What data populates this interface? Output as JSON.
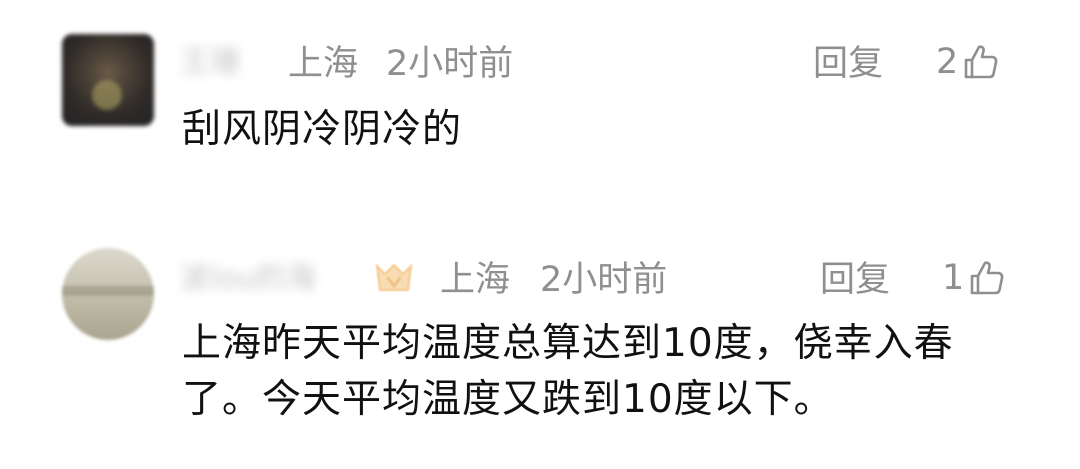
{
  "comments": [
    {
      "username": "王珊",
      "location": "上海",
      "time": "2小时前",
      "reply_label": "回复",
      "like_count": "2",
      "text": "刮风阴冷阴冷的"
    },
    {
      "username": "波lou的海",
      "location": "上海",
      "time": "2小时前",
      "reply_label": "回复",
      "like_count": "1",
      "text": "上海昨天平均温度总算达到10度，侥幸入春了。今天平均温度又跌到10度以下。"
    }
  ],
  "icons": {
    "like": "thumbs-up-icon",
    "badge": "vip-badge-icon"
  },
  "colors": {
    "meta_text": "#8f8f8f",
    "body_text": "#111111",
    "badge": "#f2b866"
  }
}
